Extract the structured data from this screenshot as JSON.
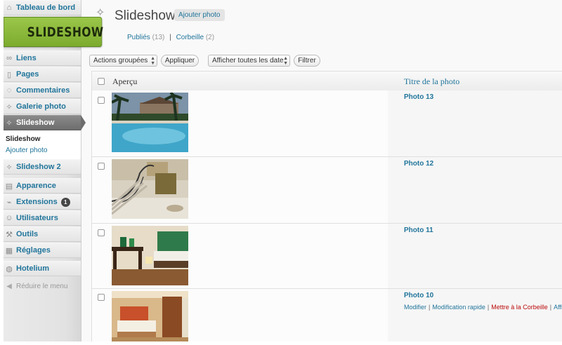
{
  "sidebar": {
    "dashboard": "Tableau de bord",
    "items": [
      {
        "label": "Liens",
        "icon": "link-icon"
      },
      {
        "label": "Pages",
        "icon": "pages-icon"
      },
      {
        "label": "Commentaires",
        "icon": "comments-icon"
      },
      {
        "label": "Galerie photo",
        "icon": "gallery-icon"
      },
      {
        "label": "Slideshow",
        "icon": "slideshow-icon"
      }
    ],
    "submenu": {
      "current": "Slideshow",
      "add": "Ajouter photo"
    },
    "items2": [
      {
        "label": "Slideshow 2",
        "icon": "slideshow-icon"
      },
      {
        "label": "Apparence",
        "icon": "appearance-icon"
      },
      {
        "label": "Extensions",
        "icon": "plugins-icon",
        "badge": "1"
      },
      {
        "label": "Utilisateurs",
        "icon": "users-icon"
      },
      {
        "label": "Outils",
        "icon": "tools-icon"
      },
      {
        "label": "Réglages",
        "icon": "settings-icon"
      },
      {
        "label": "Hotelium",
        "icon": "hotelium-icon"
      }
    ],
    "collapse": "Réduire le menu"
  },
  "banner": {
    "text": "SLIDESHOW",
    "color": "#8bbb3a"
  },
  "header": {
    "title": "Slideshow",
    "add_new": "Ajouter photo",
    "published_label": "Publiés",
    "published_count": "(13)",
    "trash_label": "Corbeille",
    "trash_count": "(2)"
  },
  "filters": {
    "bulk_actions": "Actions groupées",
    "apply": "Appliquer",
    "dates": "Afficher toutes les date",
    "filter": "Filtrer"
  },
  "table": {
    "col_preview": "Aperçu",
    "col_title": "Titre de la photo",
    "rows": [
      {
        "title": "Photo 13",
        "scene": "pool"
      },
      {
        "title": "Photo 12",
        "scene": "staircase"
      },
      {
        "title": "Photo 11",
        "scene": "bedroom-green"
      },
      {
        "title": "Photo 10",
        "scene": "bedroom-orange"
      }
    ],
    "row_actions": {
      "edit": "Modifier",
      "quick_edit": "Modification rapide",
      "trash": "Mettre à la Corbeille",
      "view": "Affi"
    }
  },
  "colors": {
    "accent": "#21759b",
    "danger": "#bc0b0b",
    "active_menu": "#6d6d6d"
  }
}
